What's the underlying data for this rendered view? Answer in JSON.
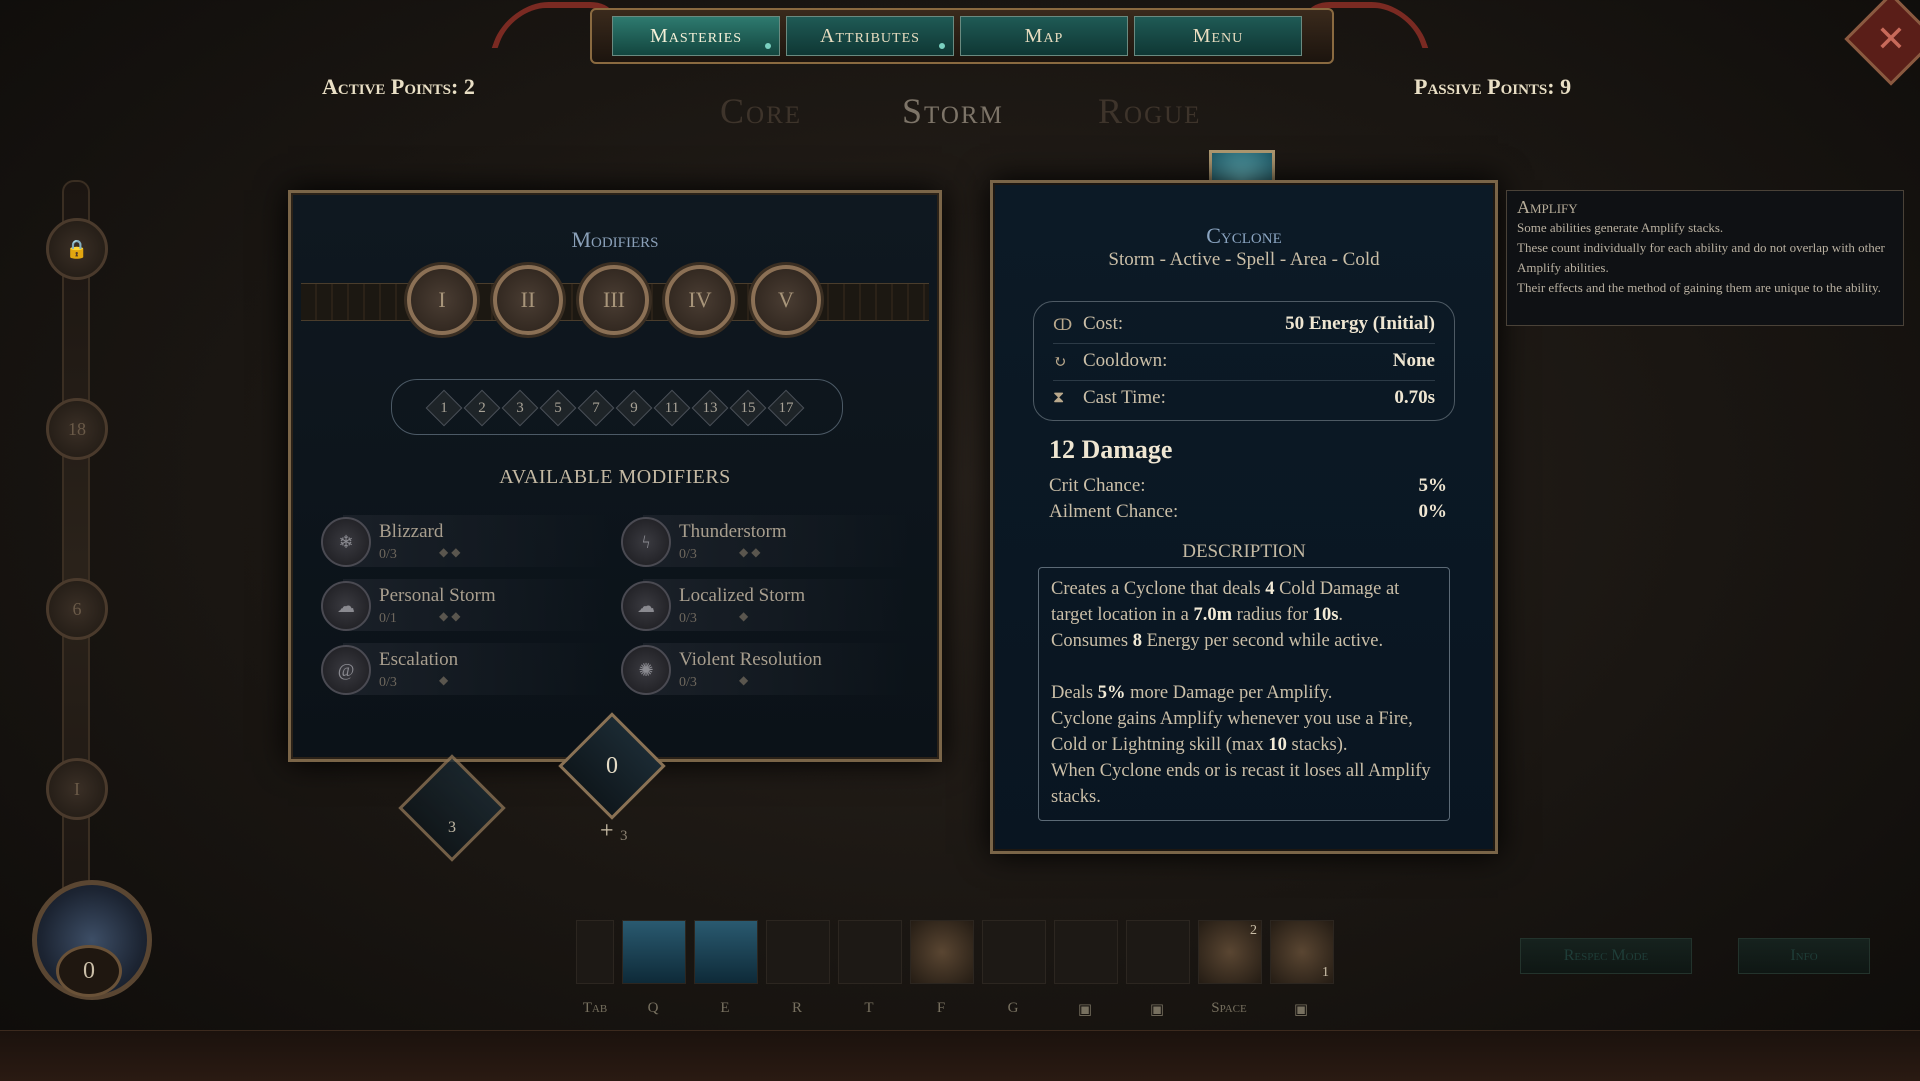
{
  "nav": {
    "tabs": [
      {
        "label": "Masteries",
        "active": true
      },
      {
        "label": "Attributes",
        "active": false
      },
      {
        "label": "Map",
        "active": false
      },
      {
        "label": "Menu",
        "active": false
      }
    ]
  },
  "points": {
    "active_label": "Active Points:",
    "active_value": "2",
    "passive_label": "Passive Points:",
    "passive_value": "9"
  },
  "mastery_tabs": [
    "Core",
    "Storm",
    "Rogue"
  ],
  "modifiers_panel": {
    "title": "Modifiers",
    "tiers": [
      "I",
      "II",
      "III",
      "IV",
      "V"
    ],
    "levels": [
      "1",
      "2",
      "3",
      "5",
      "7",
      "9",
      "11",
      "13",
      "15",
      "17"
    ],
    "available_title": "AVAILABLE MODIFIERS",
    "modifiers": [
      {
        "name": "Blizzard",
        "count": "0/3",
        "pips": "◆◆",
        "icon": "snowflake-icon"
      },
      {
        "name": "Thunderstorm",
        "count": "0/3",
        "pips": "◆◆",
        "icon": "lightning-icon"
      },
      {
        "name": "Personal Storm",
        "count": "0/1",
        "pips": "◆◆",
        "icon": "storm-icon"
      },
      {
        "name": "Localized Storm",
        "count": "0/3",
        "pips": "◆",
        "icon": "storm-icon"
      },
      {
        "name": "Escalation",
        "count": "0/3",
        "pips": "◆",
        "icon": "spiral-icon"
      },
      {
        "name": "Violent Resolution",
        "count": "0/3",
        "pips": "◆",
        "icon": "burst-icon"
      }
    ],
    "badge_value": "0",
    "left_badge_value": "3",
    "plus": "+",
    "plus_badge_value": "3"
  },
  "skill": {
    "name": "Cyclone",
    "tags": "Storm - Active - Spell - Area - Cold",
    "stats": [
      {
        "label": "Cost:",
        "value": "50 Energy (Initial)",
        "icon": "energy-icon"
      },
      {
        "label": "Cooldown:",
        "value": "None",
        "icon": "cooldown-icon"
      },
      {
        "label": "Cast Time:",
        "value": "0.70s",
        "icon": "hourglass-icon"
      }
    ],
    "damage": "12 Damage",
    "crit_label": "Crit Chance:",
    "crit_value": "5%",
    "ailment_label": "Ailment Chance:",
    "ailment_value": "0%",
    "description_title": "DESCRIPTION",
    "description": {
      "p1_a": "Creates a Cyclone that deals ",
      "p1_b": "4",
      "p1_c": " Cold Damage at target location in a ",
      "p1_d": "7.0m",
      "p1_e": " radius for ",
      "p1_f": "10s",
      "p1_g": ".",
      "p2_a": "Consumes ",
      "p2_b": "8",
      "p2_c": " Energy per second while active.",
      "p3_a": "Deals ",
      "p3_b": "5%",
      "p3_c": " more Damage per Amplify.",
      "p4_a": "Cyclone gains Amplify whenever you use a Fire, Cold or Lightning skill (max ",
      "p4_b": "10",
      "p4_c": " stacks).",
      "p5": "When Cyclone ends or is recast it loses all Amplify stacks."
    }
  },
  "tooltip": {
    "title": "Amplify",
    "lines": [
      "Some abilities generate Amplify stacks.",
      "These count individually for each ability and do not overlap with other Amplify abilities.",
      "Their effects and the method of gaining them are unique to the ability."
    ]
  },
  "rail": {
    "nodes": [
      "18",
      "6",
      "I"
    ],
    "orb_value": "0"
  },
  "hotbar": {
    "keys": [
      "Tab",
      "Q",
      "E",
      "R",
      "T",
      "F",
      "G",
      "",
      "",
      "Space",
      ""
    ],
    "slot_badge": "2",
    "slot_badge2": "1"
  },
  "buttons": {
    "respec": "Respec Mode",
    "info": "Info"
  },
  "colors": {
    "accent_teal": "#1f5a55",
    "panel_border": "#7a6548",
    "close_red": "#5a1e18"
  }
}
